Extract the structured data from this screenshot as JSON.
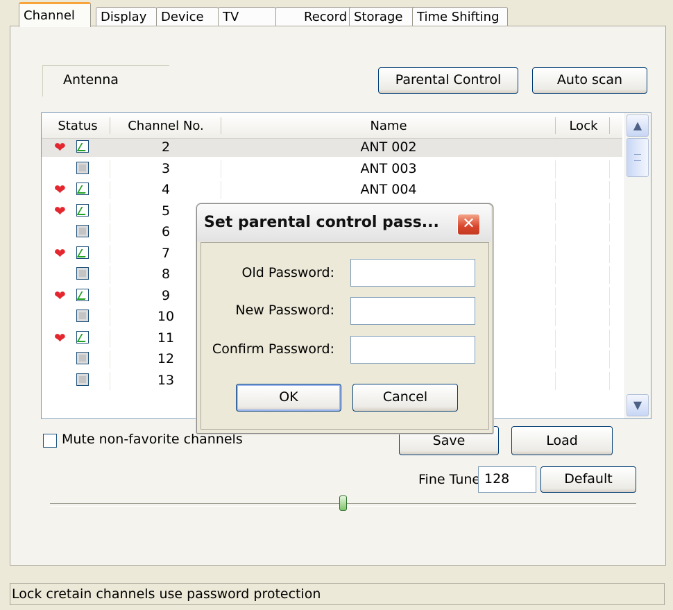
{
  "tabs": [
    "Channel",
    "Display",
    "Device",
    "TV",
    "Record",
    "Storage",
    "Time Shifting"
  ],
  "active_tab": "Channel",
  "source_group": "Antenna",
  "buttons": {
    "parental": "Parental Control",
    "autoscan": "Auto scan",
    "save": "Save",
    "load": "Load",
    "default": "Default"
  },
  "columns": {
    "status": "Status",
    "channel": "Channel No.",
    "name": "Name",
    "lock": "Lock"
  },
  "rows": [
    {
      "fav": true,
      "checked": true,
      "channel": "2",
      "name": "ANT 002",
      "selected": true
    },
    {
      "fav": false,
      "checked": false,
      "channel": "3",
      "name": "ANT 003"
    },
    {
      "fav": true,
      "checked": true,
      "channel": "4",
      "name": "ANT 004"
    },
    {
      "fav": true,
      "checked": true,
      "channel": "5",
      "name": ""
    },
    {
      "fav": false,
      "checked": false,
      "channel": "6",
      "name": ""
    },
    {
      "fav": true,
      "checked": true,
      "channel": "7",
      "name": ""
    },
    {
      "fav": false,
      "checked": false,
      "channel": "8",
      "name": ""
    },
    {
      "fav": true,
      "checked": true,
      "channel": "9",
      "name": ""
    },
    {
      "fav": false,
      "checked": false,
      "channel": "10",
      "name": ""
    },
    {
      "fav": true,
      "checked": true,
      "channel": "11",
      "name": ""
    },
    {
      "fav": false,
      "checked": false,
      "channel": "12",
      "name": ""
    },
    {
      "fav": false,
      "checked": false,
      "channel": "13",
      "name": ""
    }
  ],
  "mute_label": "Mute non-favorite channels",
  "fine_tune": {
    "label": "Fine Tune",
    "value": "128"
  },
  "status_bar": "Lock cretain channels use password protection",
  "dialog": {
    "title": "Set parental control pass...",
    "old_label": "Old Password:",
    "new_label": "New Password:",
    "confirm_label": "Confirm Password:",
    "ok": "OK",
    "cancel": "Cancel"
  },
  "icons": {
    "favorite": "heart-icon",
    "close": "close-icon",
    "scroll_up": "chevron-up-icon",
    "scroll_down": "chevron-down-icon"
  },
  "colors": {
    "favorite": "#e4262e",
    "tab_accent": "#f7a43a",
    "close_button": "#d8452c"
  }
}
